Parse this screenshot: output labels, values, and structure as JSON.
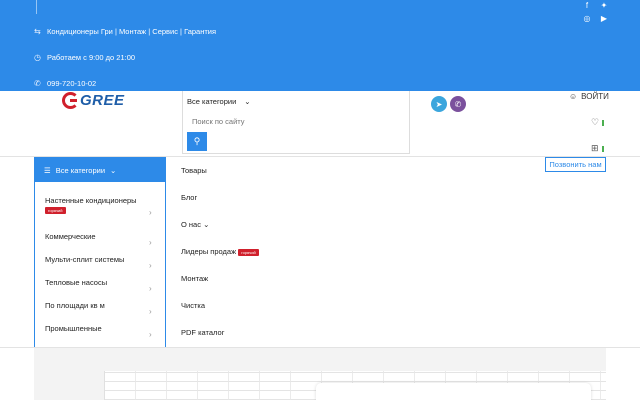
{
  "topbar": {
    "nav_text": "Кондиционеры Гри | Монтаж | Сервис | Гарантия",
    "hours": "Работаем с 9:00 до 21:00",
    "phone": "099-720-10-02",
    "socials": [
      "facebook-icon",
      "twitter-icon",
      "instagram-icon",
      "youtube-icon"
    ]
  },
  "logo": {
    "text": "GREE"
  },
  "search": {
    "category": "Все категории",
    "placeholder": "Поиск по сайту"
  },
  "header": {
    "login": "ВОЙТИ",
    "call_button": "Позвонить нам"
  },
  "catalog": {
    "title": "Все категории",
    "badge": "горячий",
    "items": [
      "Настенные кондиционеры",
      "Коммерческие",
      "Мульти-сплит системы",
      "Тепловые насосы",
      "По площади кв м",
      "Промышленные"
    ]
  },
  "nav": {
    "items": [
      "Товары",
      "Блог",
      "О нас",
      "Лидеры продаж",
      "Монтаж",
      "Чистка",
      "PDF каталог"
    ]
  },
  "colors": {
    "accent": "#2d8ae8",
    "hot": "#d0202c",
    "telegram": "#3ba6dd",
    "viber": "#7b519d"
  }
}
